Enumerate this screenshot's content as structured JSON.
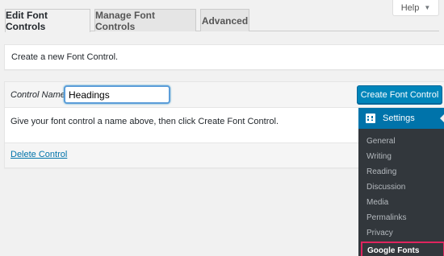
{
  "help": {
    "label": "Help",
    "arrow": "▼"
  },
  "tabs": [
    {
      "label": "Edit Font Controls",
      "active": true
    },
    {
      "label": "Manage Font Controls",
      "active": false
    },
    {
      "label": "Advanced",
      "active": false
    }
  ],
  "notice": {
    "text": "Create a new Font Control."
  },
  "form": {
    "control_label": "Control Name",
    "control_value": "Headings",
    "create_button": "Create Font Control",
    "help_text": "Give your font control a name above, then click Create Font Control.",
    "delete_link": "Delete Control"
  },
  "admin_menu": {
    "header": "Settings",
    "header_icon": "settings-icon",
    "items": [
      {
        "label": "General"
      },
      {
        "label": "Writing"
      },
      {
        "label": "Reading"
      },
      {
        "label": "Discussion"
      },
      {
        "label": "Media"
      },
      {
        "label": "Permalinks"
      },
      {
        "label": "Privacy"
      },
      {
        "label": "Google Fonts",
        "current": true
      }
    ]
  },
  "colors": {
    "primary": "#0085ba",
    "menu_bg": "#32373c",
    "menu_active": "#0073aa",
    "highlight": "#e0245e"
  }
}
